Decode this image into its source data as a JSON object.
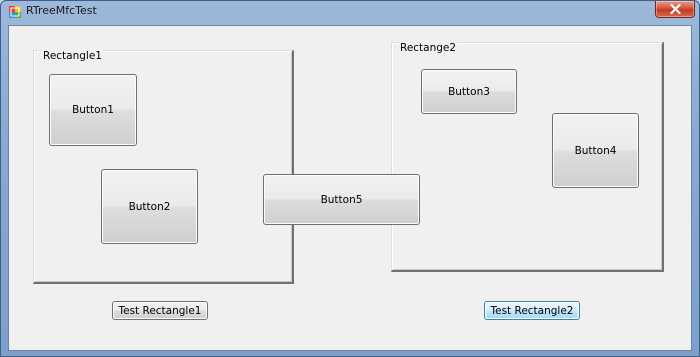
{
  "window": {
    "title": "RTreeMfcTest",
    "app_icon": "mfc-app-icon",
    "close_icon": "close-icon"
  },
  "groups": {
    "rect1_label": "Rectangle1",
    "rect2_label": "Rectange2"
  },
  "buttons": {
    "button1": "Button1",
    "button2": "Button2",
    "button3": "Button3",
    "button4": "Button4",
    "button5": "Button5",
    "test_rect1": "Test Rectangle1",
    "test_rect2": "Test Rectangle2"
  },
  "colors": {
    "client_bg": "#f0f0f0",
    "title_bar": "#8aaad2",
    "close_button": "#c94f32",
    "default_button_border": "#3c7fb1"
  }
}
